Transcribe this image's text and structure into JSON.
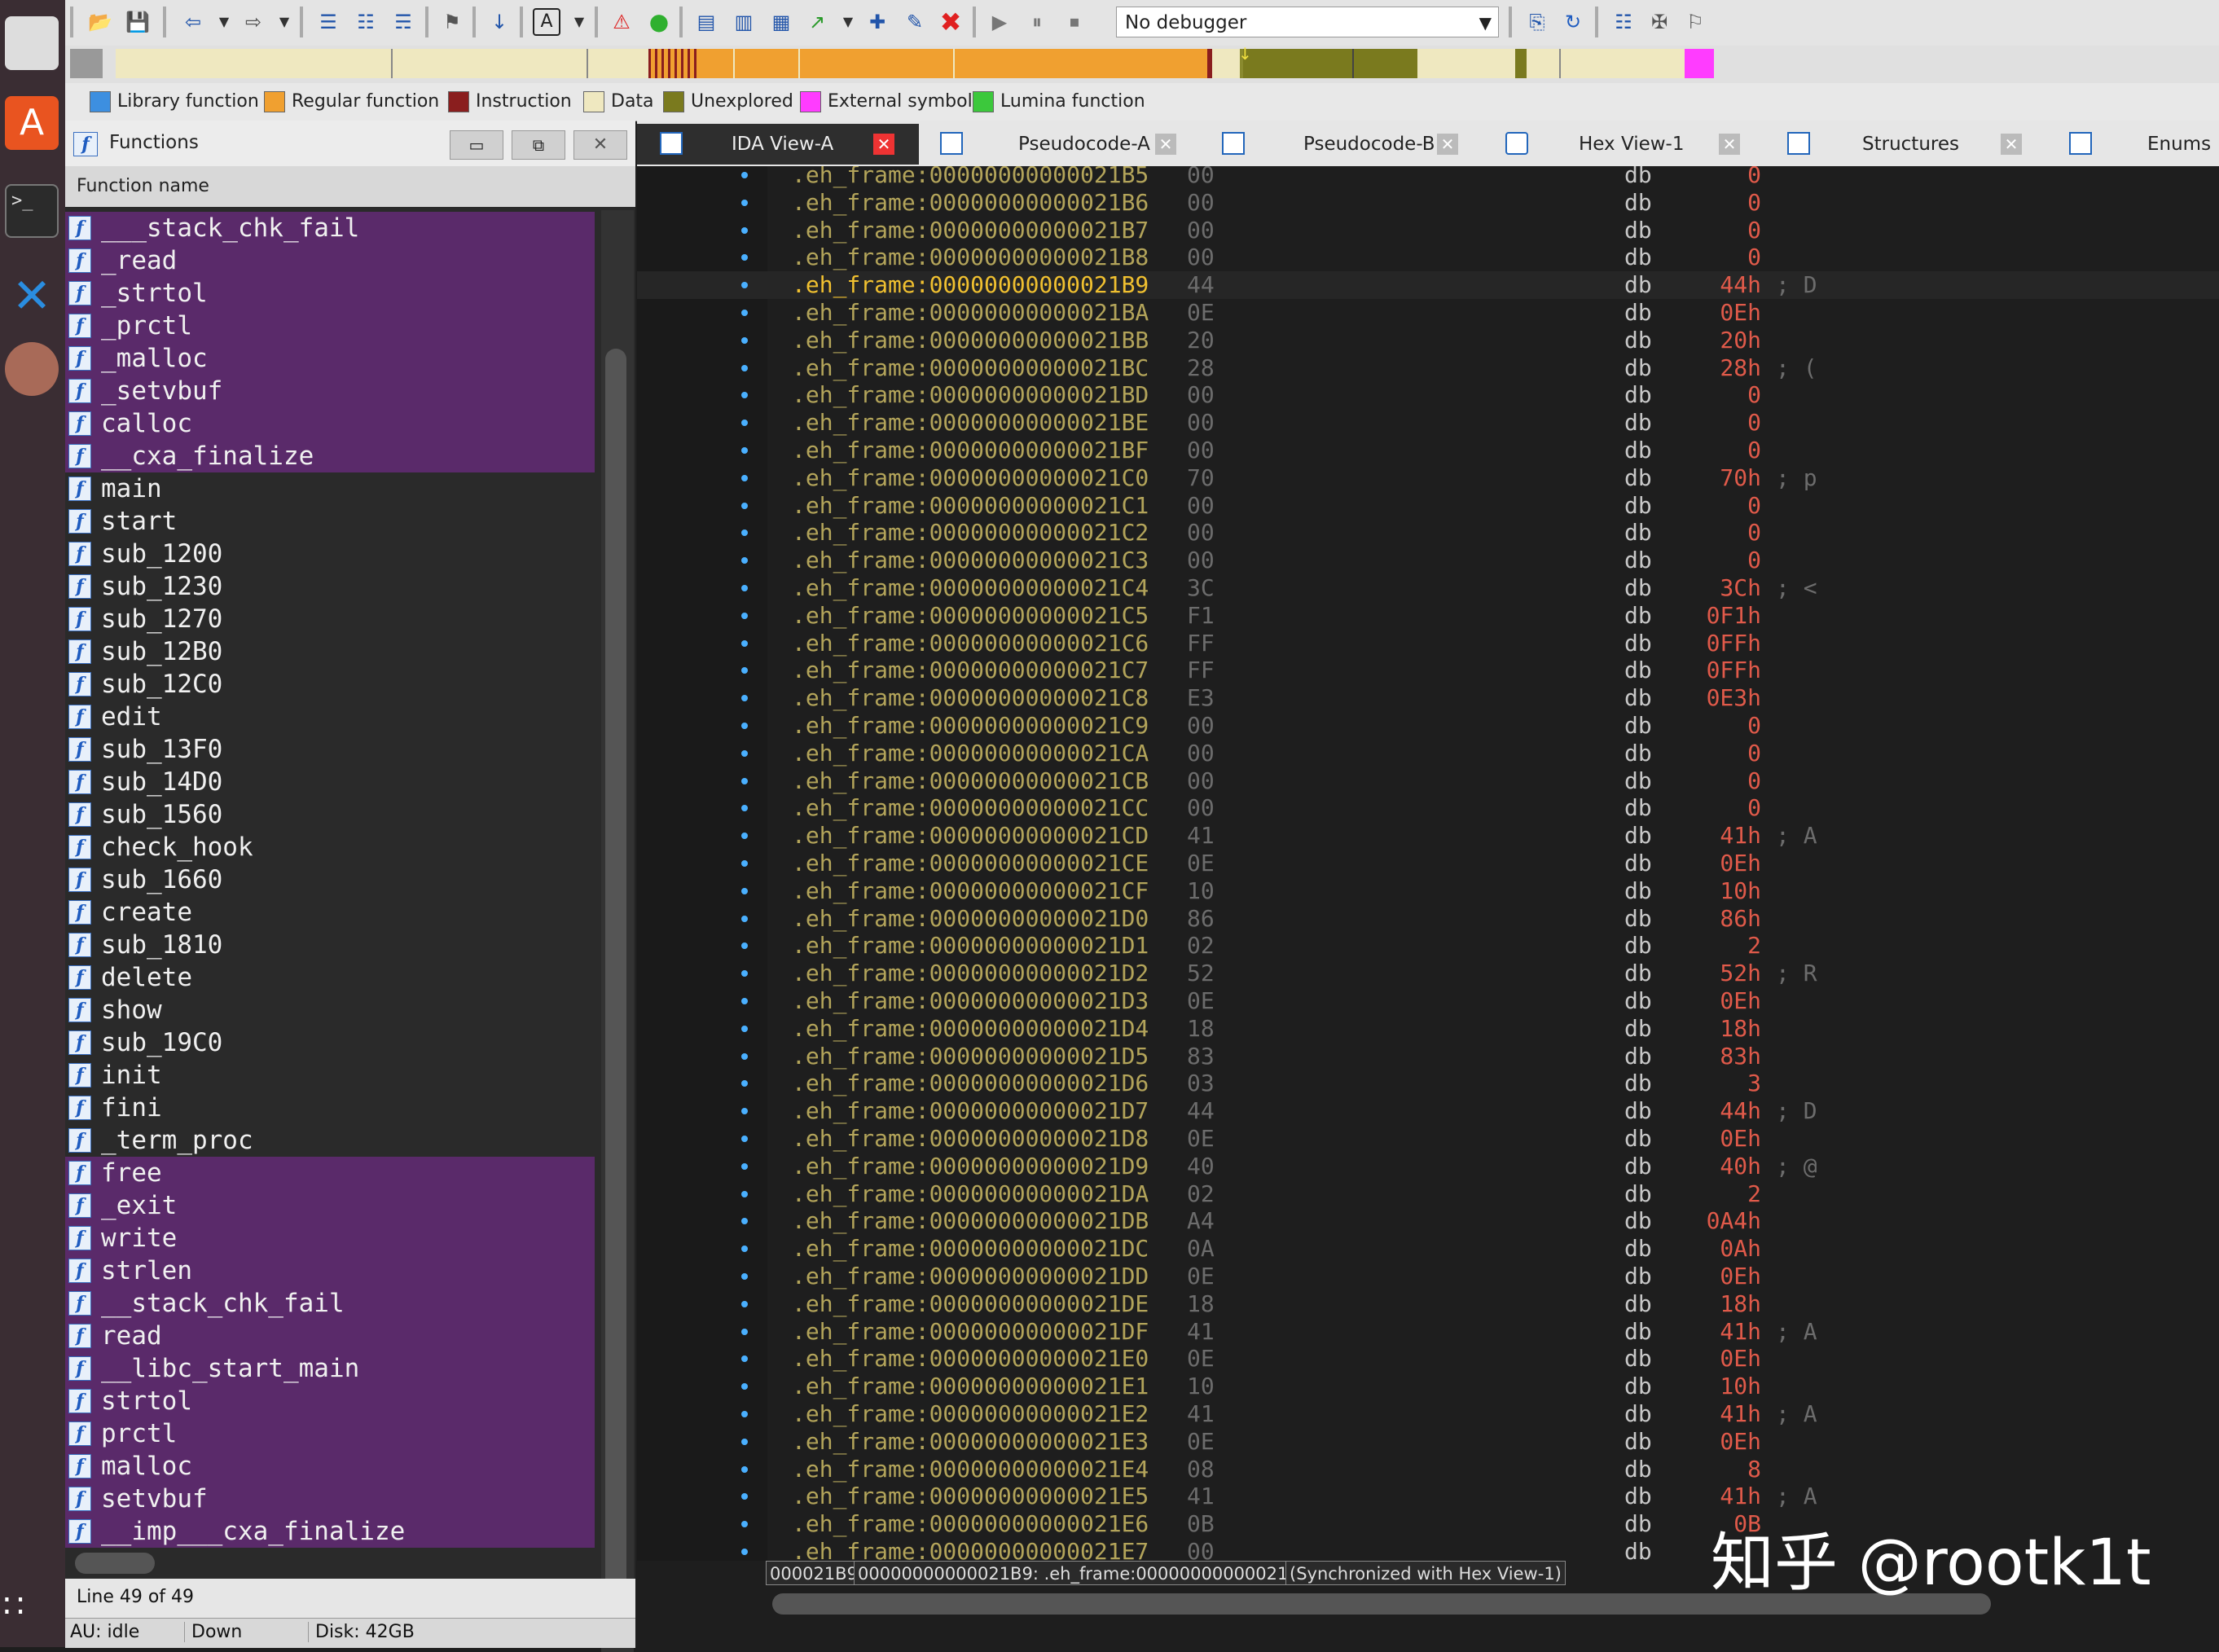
{
  "toolbar": {
    "debugger_select": "No debugger"
  },
  "legend": [
    {
      "label": "Library function",
      "color": "#3d8fe0"
    },
    {
      "label": "Regular function",
      "color": "#f0a030"
    },
    {
      "label": "Instruction",
      "color": "#8a1e1e"
    },
    {
      "label": "Data",
      "color": "#efe8c0"
    },
    {
      "label": "Unexplored",
      "color": "#7a7a1e"
    },
    {
      "label": "External symbol",
      "color": "#ff3cff"
    },
    {
      "label": "Lumina function",
      "color": "#3cc83c"
    }
  ],
  "functions_panel": {
    "title": "Functions",
    "column_header": "Function name",
    "items": [
      {
        "name": "___stack_chk_fail",
        "highlighted": true
      },
      {
        "name": "_read",
        "highlighted": true
      },
      {
        "name": "_strtol",
        "highlighted": true
      },
      {
        "name": "_prctl",
        "highlighted": true
      },
      {
        "name": "_malloc",
        "highlighted": true
      },
      {
        "name": "_setvbuf",
        "highlighted": true
      },
      {
        "name": "calloc",
        "highlighted": true
      },
      {
        "name": "__cxa_finalize",
        "highlighted": true
      },
      {
        "name": "main",
        "highlighted": false
      },
      {
        "name": "start",
        "highlighted": false
      },
      {
        "name": "sub_1200",
        "highlighted": false
      },
      {
        "name": "sub_1230",
        "highlighted": false
      },
      {
        "name": "sub_1270",
        "highlighted": false
      },
      {
        "name": "sub_12B0",
        "highlighted": false
      },
      {
        "name": "sub_12C0",
        "highlighted": false
      },
      {
        "name": "edit",
        "highlighted": false
      },
      {
        "name": "sub_13F0",
        "highlighted": false
      },
      {
        "name": "sub_14D0",
        "highlighted": false
      },
      {
        "name": "sub_1560",
        "highlighted": false
      },
      {
        "name": "check_hook",
        "highlighted": false
      },
      {
        "name": "sub_1660",
        "highlighted": false
      },
      {
        "name": "create",
        "highlighted": false
      },
      {
        "name": "sub_1810",
        "highlighted": false
      },
      {
        "name": "delete",
        "highlighted": false
      },
      {
        "name": "show",
        "highlighted": false
      },
      {
        "name": "sub_19C0",
        "highlighted": false
      },
      {
        "name": "init",
        "highlighted": false
      },
      {
        "name": "fini",
        "highlighted": false
      },
      {
        "name": "_term_proc",
        "highlighted": false
      },
      {
        "name": "free",
        "highlighted": true
      },
      {
        "name": "_exit",
        "highlighted": true
      },
      {
        "name": "write",
        "highlighted": true
      },
      {
        "name": "strlen",
        "highlighted": true
      },
      {
        "name": "__stack_chk_fail",
        "highlighted": true
      },
      {
        "name": "read",
        "highlighted": true
      },
      {
        "name": "__libc_start_main",
        "highlighted": true
      },
      {
        "name": "strtol",
        "highlighted": true
      },
      {
        "name": "prctl",
        "highlighted": true
      },
      {
        "name": "malloc",
        "highlighted": true
      },
      {
        "name": "setvbuf",
        "highlighted": true
      },
      {
        "name": "__imp___cxa_finalize",
        "highlighted": true
      }
    ],
    "status_line": "Line 49 of 49",
    "au_status": "AU:  idle",
    "direction": "Down",
    "disk": "Disk: 42GB"
  },
  "tabs": [
    {
      "label": "IDA View-A",
      "active": true
    },
    {
      "label": "Pseudocode-A",
      "active": false
    },
    {
      "label": "Pseudocode-B",
      "active": false
    },
    {
      "label": "Hex View-1",
      "active": false
    },
    {
      "label": "Structures",
      "active": false
    },
    {
      "label": "Enums",
      "active": false
    }
  ],
  "disassembly": [
    {
      "address": ".eh_frame:00000000000021B5",
      "byte": "00",
      "mnemonic": "db",
      "value": "0",
      "comment": ""
    },
    {
      "address": ".eh_frame:00000000000021B6",
      "byte": "00",
      "mnemonic": "db",
      "value": "0",
      "comment": ""
    },
    {
      "address": ".eh_frame:00000000000021B7",
      "byte": "00",
      "mnemonic": "db",
      "value": "0",
      "comment": ""
    },
    {
      "address": ".eh_frame:00000000000021B8",
      "byte": "00",
      "mnemonic": "db",
      "value": "0",
      "comment": ""
    },
    {
      "address": ".eh_frame:00000000000021B9",
      "byte": "44",
      "mnemonic": "db",
      "value": "44h",
      "comment": "; D",
      "current": true
    },
    {
      "address": ".eh_frame:00000000000021BA",
      "byte": "0E",
      "mnemonic": "db",
      "value": "0Eh",
      "comment": ""
    },
    {
      "address": ".eh_frame:00000000000021BB",
      "byte": "20",
      "mnemonic": "db",
      "value": "20h",
      "comment": ""
    },
    {
      "address": ".eh_frame:00000000000021BC",
      "byte": "28",
      "mnemonic": "db",
      "value": "28h",
      "comment": "; ("
    },
    {
      "address": ".eh_frame:00000000000021BD",
      "byte": "00",
      "mnemonic": "db",
      "value": "0",
      "comment": ""
    },
    {
      "address": ".eh_frame:00000000000021BE",
      "byte": "00",
      "mnemonic": "db",
      "value": "0",
      "comment": ""
    },
    {
      "address": ".eh_frame:00000000000021BF",
      "byte": "00",
      "mnemonic": "db",
      "value": "0",
      "comment": ""
    },
    {
      "address": ".eh_frame:00000000000021C0",
      "byte": "70",
      "mnemonic": "db",
      "value": "70h",
      "comment": "; p"
    },
    {
      "address": ".eh_frame:00000000000021C1",
      "byte": "00",
      "mnemonic": "db",
      "value": "0",
      "comment": ""
    },
    {
      "address": ".eh_frame:00000000000021C2",
      "byte": "00",
      "mnemonic": "db",
      "value": "0",
      "comment": ""
    },
    {
      "address": ".eh_frame:00000000000021C3",
      "byte": "00",
      "mnemonic": "db",
      "value": "0",
      "comment": ""
    },
    {
      "address": ".eh_frame:00000000000021C4",
      "byte": "3C",
      "mnemonic": "db",
      "value": "3Ch",
      "comment": "; <"
    },
    {
      "address": ".eh_frame:00000000000021C5",
      "byte": "F1",
      "mnemonic": "db",
      "value": "0F1h",
      "comment": ""
    },
    {
      "address": ".eh_frame:00000000000021C6",
      "byte": "FF",
      "mnemonic": "db",
      "value": "0FFh",
      "comment": ""
    },
    {
      "address": ".eh_frame:00000000000021C7",
      "byte": "FF",
      "mnemonic": "db",
      "value": "0FFh",
      "comment": ""
    },
    {
      "address": ".eh_frame:00000000000021C8",
      "byte": "E3",
      "mnemonic": "db",
      "value": "0E3h",
      "comment": ""
    },
    {
      "address": ".eh_frame:00000000000021C9",
      "byte": "00",
      "mnemonic": "db",
      "value": "0",
      "comment": ""
    },
    {
      "address": ".eh_frame:00000000000021CA",
      "byte": "00",
      "mnemonic": "db",
      "value": "0",
      "comment": ""
    },
    {
      "address": ".eh_frame:00000000000021CB",
      "byte": "00",
      "mnemonic": "db",
      "value": "0",
      "comment": ""
    },
    {
      "address": ".eh_frame:00000000000021CC",
      "byte": "00",
      "mnemonic": "db",
      "value": "0",
      "comment": ""
    },
    {
      "address": ".eh_frame:00000000000021CD",
      "byte": "41",
      "mnemonic": "db",
      "value": "41h",
      "comment": "; A"
    },
    {
      "address": ".eh_frame:00000000000021CE",
      "byte": "0E",
      "mnemonic": "db",
      "value": "0Eh",
      "comment": ""
    },
    {
      "address": ".eh_frame:00000000000021CF",
      "byte": "10",
      "mnemonic": "db",
      "value": "10h",
      "comment": ""
    },
    {
      "address": ".eh_frame:00000000000021D0",
      "byte": "86",
      "mnemonic": "db",
      "value": "86h",
      "comment": ""
    },
    {
      "address": ".eh_frame:00000000000021D1",
      "byte": "02",
      "mnemonic": "db",
      "value": "2",
      "comment": ""
    },
    {
      "address": ".eh_frame:00000000000021D2",
      "byte": "52",
      "mnemonic": "db",
      "value": "52h",
      "comment": "; R"
    },
    {
      "address": ".eh_frame:00000000000021D3",
      "byte": "0E",
      "mnemonic": "db",
      "value": "0Eh",
      "comment": ""
    },
    {
      "address": ".eh_frame:00000000000021D4",
      "byte": "18",
      "mnemonic": "db",
      "value": "18h",
      "comment": ""
    },
    {
      "address": ".eh_frame:00000000000021D5",
      "byte": "83",
      "mnemonic": "db",
      "value": "83h",
      "comment": ""
    },
    {
      "address": ".eh_frame:00000000000021D6",
      "byte": "03",
      "mnemonic": "db",
      "value": "3",
      "comment": ""
    },
    {
      "address": ".eh_frame:00000000000021D7",
      "byte": "44",
      "mnemonic": "db",
      "value": "44h",
      "comment": "; D"
    },
    {
      "address": ".eh_frame:00000000000021D8",
      "byte": "0E",
      "mnemonic": "db",
      "value": "0Eh",
      "comment": ""
    },
    {
      "address": ".eh_frame:00000000000021D9",
      "byte": "40",
      "mnemonic": "db",
      "value": "40h",
      "comment": "; @"
    },
    {
      "address": ".eh_frame:00000000000021DA",
      "byte": "02",
      "mnemonic": "db",
      "value": "2",
      "comment": ""
    },
    {
      "address": ".eh_frame:00000000000021DB",
      "byte": "A4",
      "mnemonic": "db",
      "value": "0A4h",
      "comment": ""
    },
    {
      "address": ".eh_frame:00000000000021DC",
      "byte": "0A",
      "mnemonic": "db",
      "value": "0Ah",
      "comment": ""
    },
    {
      "address": ".eh_frame:00000000000021DD",
      "byte": "0E",
      "mnemonic": "db",
      "value": "0Eh",
      "comment": ""
    },
    {
      "address": ".eh_frame:00000000000021DE",
      "byte": "18",
      "mnemonic": "db",
      "value": "18h",
      "comment": ""
    },
    {
      "address": ".eh_frame:00000000000021DF",
      "byte": "41",
      "mnemonic": "db",
      "value": "41h",
      "comment": "; A"
    },
    {
      "address": ".eh_frame:00000000000021E0",
      "byte": "0E",
      "mnemonic": "db",
      "value": "0Eh",
      "comment": ""
    },
    {
      "address": ".eh_frame:00000000000021E1",
      "byte": "10",
      "mnemonic": "db",
      "value": "10h",
      "comment": ""
    },
    {
      "address": ".eh_frame:00000000000021E2",
      "byte": "41",
      "mnemonic": "db",
      "value": "41h",
      "comment": "; A"
    },
    {
      "address": ".eh_frame:00000000000021E3",
      "byte": "0E",
      "mnemonic": "db",
      "value": "0Eh",
      "comment": ""
    },
    {
      "address": ".eh_frame:00000000000021E4",
      "byte": "08",
      "mnemonic": "db",
      "value": "8",
      "comment": ""
    },
    {
      "address": ".eh_frame:00000000000021E5",
      "byte": "41",
      "mnemonic": "db",
      "value": "41h",
      "comment": "; A"
    },
    {
      "address": ".eh_frame:00000000000021E6",
      "byte": "0B",
      "mnemonic": "db",
      "value": "0B",
      "comment": ""
    },
    {
      "address": ".eh_frame:00000000000021E7",
      "byte": "00",
      "mnemonic": "db",
      "value": "",
      "comment": ""
    }
  ],
  "status_bar": {
    "offset": "000021B9",
    "location": "00000000000021B9: .eh_frame:00000000000021B9",
    "sync": "(Synchronized with Hex View-1)"
  },
  "watermark": "知乎 @rootk1t"
}
